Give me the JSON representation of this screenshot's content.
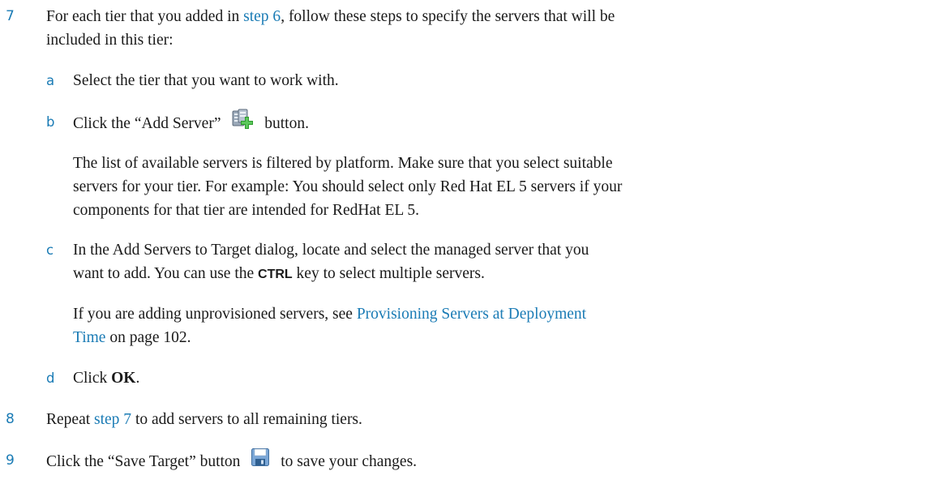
{
  "step7": {
    "number": "7",
    "intro_pre": "For each tier that you added in ",
    "intro_link": "step 6",
    "intro_post": ", follow these steps to specify the servers that will be",
    "intro_line2": "included in this tier:",
    "a": {
      "letter": "a",
      "text": "Select the tier that you want to work with."
    },
    "b": {
      "letter": "b",
      "pre": "Click the “Add Server”",
      "post": "button.",
      "icon": "add-server-icon",
      "para_line1": "The list of available servers is filtered by platform. Make sure that you select suitable",
      "para_line2": "servers for your tier. For example: You should select only Red Hat EL 5 servers if your",
      "para_line3": "components for that tier are intended for RedHat EL 5."
    },
    "c": {
      "letter": "c",
      "line1": "In the Add Servers to Target dialog, locate and select the managed server that you",
      "line2_pre": "want to add. You can use the ",
      "line2_key": "CTRL",
      "line2_post": " key to select multiple servers.",
      "para_pre": "If you are adding unprovisioned servers, see ",
      "para_link1": "Provisioning Servers at Deployment",
      "para_link2": "Time",
      "para_post": " on page 102."
    },
    "d": {
      "letter": "d",
      "pre": "Click ",
      "bold": "OK",
      "post": "."
    }
  },
  "step8": {
    "number": "8",
    "pre": "Repeat ",
    "link": "step 7",
    "post": " to add servers to all remaining tiers."
  },
  "step9": {
    "number": "9",
    "pre": "Click the “Save Target” button",
    "post": "to save your changes.",
    "icon": "save-icon"
  }
}
